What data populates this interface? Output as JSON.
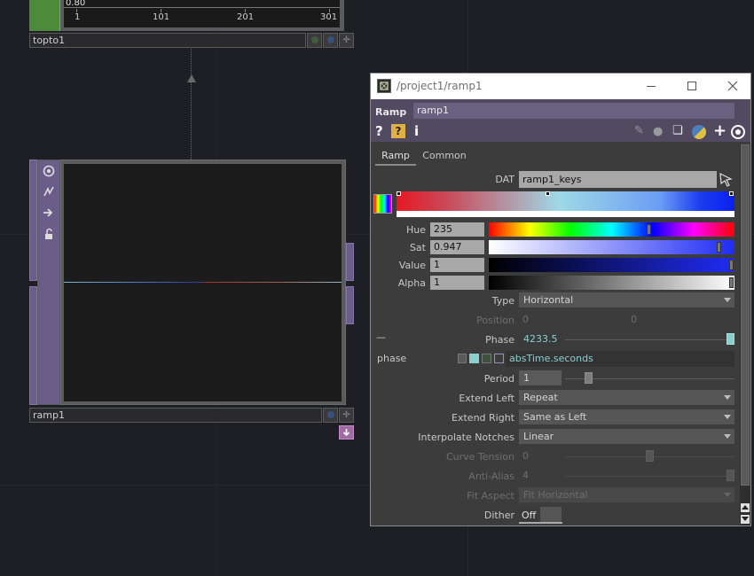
{
  "top_node": {
    "name": "topto1",
    "graph_top_value": "0.80",
    "ticks": [
      "1",
      "101",
      "201",
      "301"
    ]
  },
  "ramp_node": {
    "name": "ramp1"
  },
  "window": {
    "title": "/project1/ramp1",
    "op_type": "Ramp",
    "op_name": "ramp1",
    "help_icon": "?",
    "python_help_icon": "?",
    "info_icon": "i",
    "tabs": [
      {
        "label": "Ramp",
        "active": true
      },
      {
        "label": "Common",
        "active": false
      }
    ],
    "params": {
      "dat": {
        "label": "DAT",
        "value": "ramp1_keys"
      },
      "hue": {
        "label": "Hue",
        "value": "235",
        "fraction": 0.655
      },
      "sat": {
        "label": "Sat",
        "value": "0.947",
        "fraction": 0.947
      },
      "value": {
        "label": "Value",
        "value": "1",
        "fraction": 1.0
      },
      "alpha": {
        "label": "Alpha",
        "value": "1",
        "fraction": 1.0
      },
      "type": {
        "label": "Type",
        "value": "Horizontal"
      },
      "position": {
        "label": "Position",
        "value1": "0",
        "value2": "0"
      },
      "phase": {
        "label": "Phase",
        "value": "4233.5",
        "fraction": 1.0,
        "minus": "—"
      },
      "phase_expr": {
        "label": "phase",
        "value": "absTime.seconds"
      },
      "period": {
        "label": "Period",
        "value": "1",
        "fraction": 0.12
      },
      "extend_left": {
        "label": "Extend Left",
        "value": "Repeat"
      },
      "extend_right": {
        "label": "Extend Right",
        "value": "Same as Left"
      },
      "interpolate": {
        "label": "Interpolate Notches",
        "value": "Linear"
      },
      "curve_tension": {
        "label": "Curve Tension",
        "value": "0",
        "fraction": 0.5
      },
      "anti_alias": {
        "label": "Anti-Alias",
        "value": "4",
        "fraction": 1.0
      },
      "fit_aspect": {
        "label": "Fit Aspect",
        "value": "Fit Horizontal"
      },
      "dither": {
        "label": "Dither",
        "value": "Off"
      }
    }
  },
  "colors": {
    "header": "#514a60",
    "canvas": "#1d1f24",
    "accent": "#8acfd0"
  }
}
